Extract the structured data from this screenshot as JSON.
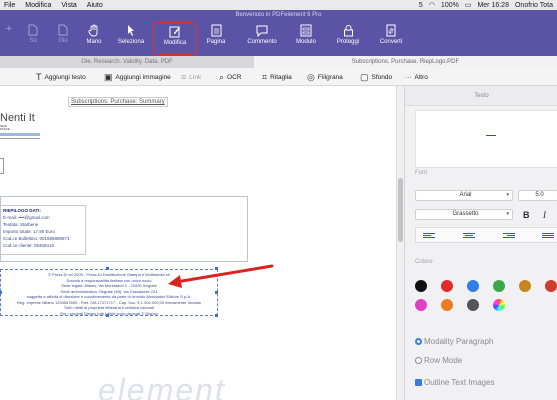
{
  "menubar": {
    "items": [
      "File",
      "Modifica",
      "Vista",
      "Aiuto"
    ],
    "status": "100%",
    "clock": "Mer 16:28",
    "user": "Onofrio Tota",
    "badge": "5"
  },
  "app": {
    "title": "Benvenuto in PDFelement 6 Pro",
    "tools": [
      {
        "label": "+",
        "icon": "add-icon"
      },
      {
        "label": "Sù",
        "icon": "page-up-icon"
      },
      {
        "label": "Giù",
        "icon": "page-down-icon"
      },
      {
        "label": "Mano",
        "icon": "hand-icon"
      },
      {
        "label": "Seleziona",
        "icon": "cursor-icon"
      },
      {
        "label": "Modifica",
        "icon": "edit-icon"
      },
      {
        "label": "Pagina",
        "icon": "page-icon"
      },
      {
        "label": "Commento",
        "icon": "comment-icon"
      },
      {
        "label": "Modulo",
        "icon": "form-icon"
      },
      {
        "label": "Proteggi",
        "icon": "lock-icon"
      },
      {
        "label": "Converti",
        "icon": "convert-icon"
      }
    ]
  },
  "tabs": [
    {
      "label": "Gle. Research. Validity. Data. PDF"
    },
    {
      "label": "Subscriptions. Purchase. RiepLogo.PDF"
    }
  ],
  "edit_tools": {
    "add_text": "Aggiungi testo",
    "add_image": "Aggiungi immagine",
    "link": "Link",
    "ocr": "OCR",
    "crop": "Ritaglia",
    "watermark": "Filigrana",
    "background": "Sfondo",
    "more_dots": "···",
    "more": "Altro"
  },
  "document": {
    "page_title": "Subscriptions: Purchase: Summary",
    "brand": "Nenti It",
    "brand_small_1": "NEW",
    "brand_small_2": "PASSE",
    "summary_heading": "RIEPILOGO DATI:",
    "summary_lines": [
      "E-mail: ••••@gmail.com",
      "Testata: Starbene",
      "Importo totale: 17,90 Euro",
      "Cod.ce Bollettino: 001688889871",
      "Cod.ce cliente: 06469415"
    ],
    "footer_lines": [
      "© Press-Di srl 2009 - Press-Di Distribuzione Stampa e Multimedia srl",
      "Società a responsabilità limitata con unico socio",
      "Sede legale: Milano, via Mondadori 1 - 20090 Segrate",
      "Sede amministrativa: Segrate (MI), via Cassanese 224",
      "soggetta a attività di direzione e coordinamento da parte di Arnoldo Mondadori Editore S.p.A.",
      "Reg. Imprese Milano 1234567890 - Part. IVA 17171717 - Cap. Soc. € 1.200.000,00 interamente Versato",
      "Tutti i diritti di proprietà letteraria e artistica riservati",
      "Per i prodotti Disney tutti i diritti sono riservati © Disney"
    ],
    "watermark_text": "element"
  },
  "panel": {
    "tab": "Testo",
    "font_section": "Font",
    "font_name": "Arial",
    "font_size": "5.0",
    "font_style": "Grassetto",
    "bold": "B",
    "italic": "I",
    "color_section": "Colore",
    "colors": [
      "#111111",
      "#e02b2b",
      "#2e7fe6",
      "#3aa64a",
      "#c8871e",
      "#cc3d2b",
      "#e040c8",
      "#f07a1e",
      "#555555",
      "#9a9a9a",
      "#d06030"
    ],
    "options": [
      {
        "label": "Modality Paragraph",
        "type": "radio",
        "checked": true
      },
      {
        "label": "Row Mode",
        "type": "radio",
        "checked": false
      },
      {
        "label": "Outline Text Images",
        "type": "checkbox",
        "checked": true
      }
    ]
  }
}
